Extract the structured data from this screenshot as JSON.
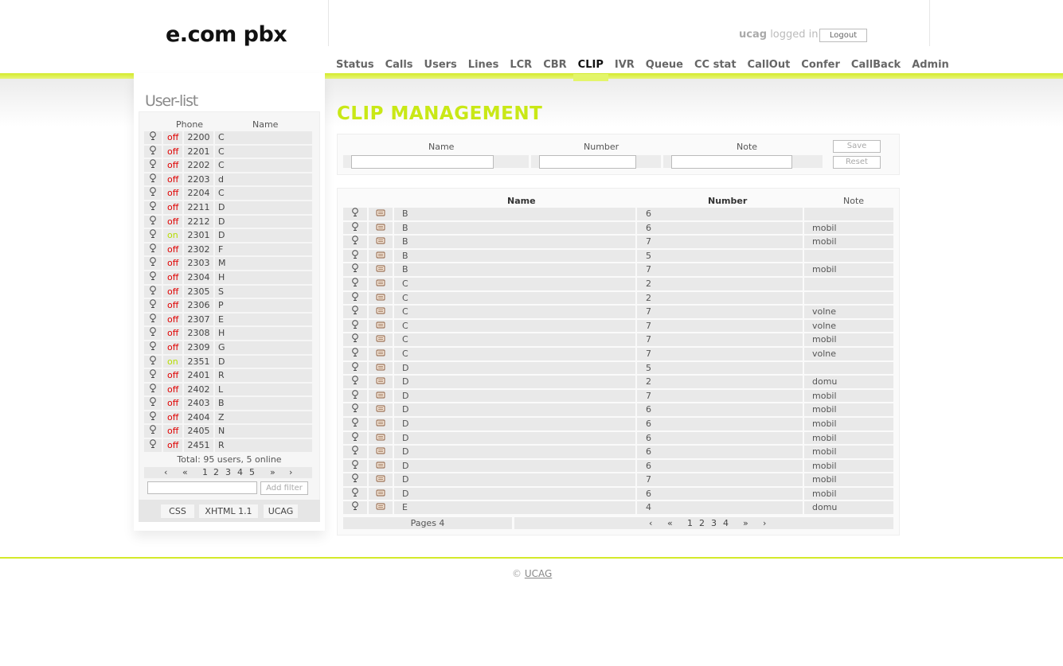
{
  "logo": "e.com pbx",
  "header": {
    "user": "ucag",
    "logged_in_text": "logged in",
    "logout_label": "Logout"
  },
  "nav": [
    "Status",
    "Calls",
    "Users",
    "Lines",
    "LCR",
    "CBR",
    "CLIP",
    "IVR",
    "Queue",
    "CC stat",
    "CallOut",
    "Confer",
    "CallBack",
    "Admin"
  ],
  "nav_active": "CLIP",
  "colors": {
    "accent": "#c9e816",
    "status_off": "#e00000",
    "status_on": "#b6dc00"
  },
  "sidebar": {
    "title": "User-list",
    "col_phone": "Phone",
    "col_name": "Name",
    "users": [
      {
        "status": "off",
        "phone": "2200",
        "name": "C"
      },
      {
        "status": "off",
        "phone": "2201",
        "name": "C"
      },
      {
        "status": "off",
        "phone": "2202",
        "name": "C"
      },
      {
        "status": "off",
        "phone": "2203",
        "name": "d"
      },
      {
        "status": "off",
        "phone": "2204",
        "name": "C"
      },
      {
        "status": "off",
        "phone": "2211",
        "name": "D"
      },
      {
        "status": "off",
        "phone": "2212",
        "name": "D"
      },
      {
        "status": "on",
        "phone": "2301",
        "name": "D"
      },
      {
        "status": "off",
        "phone": "2302",
        "name": "F"
      },
      {
        "status": "off",
        "phone": "2303",
        "name": "M"
      },
      {
        "status": "off",
        "phone": "2304",
        "name": "H"
      },
      {
        "status": "off",
        "phone": "2305",
        "name": "S"
      },
      {
        "status": "off",
        "phone": "2306",
        "name": "P"
      },
      {
        "status": "off",
        "phone": "2307",
        "name": "E"
      },
      {
        "status": "off",
        "phone": "2308",
        "name": "H"
      },
      {
        "status": "off",
        "phone": "2309",
        "name": "G"
      },
      {
        "status": "on",
        "phone": "2351",
        "name": "D"
      },
      {
        "status": "off",
        "phone": "2401",
        "name": "R"
      },
      {
        "status": "off",
        "phone": "2402",
        "name": "L"
      },
      {
        "status": "off",
        "phone": "2403",
        "name": "B"
      },
      {
        "status": "off",
        "phone": "2404",
        "name": "Z"
      },
      {
        "status": "off",
        "phone": "2405",
        "name": "N"
      },
      {
        "status": "off",
        "phone": "2451",
        "name": "R"
      }
    ],
    "total_text": "Total: 95 users, 5 online",
    "pager": {
      "first": "‹",
      "prev": "«",
      "pages": [
        "1",
        "2",
        "3",
        "4",
        "5"
      ],
      "next": "»",
      "last": "›"
    },
    "filter_value": "",
    "filter_button": "Add filter",
    "footer_badges": [
      "CSS",
      "XHTML 1.1",
      "UCAG"
    ]
  },
  "main": {
    "title": "CLIP MANAGEMENT",
    "form": {
      "name_label": "Name",
      "number_label": "Number",
      "note_label": "Note",
      "name_value": "",
      "number_value": "",
      "note_value": "",
      "save_label": "Save",
      "reset_label": "Reset"
    },
    "table": {
      "col_name": "Name",
      "col_number": "Number",
      "col_note": "Note",
      "rows": [
        {
          "name": "B",
          "number": "6",
          "note": ""
        },
        {
          "name": "B",
          "number": "6",
          "note": "mobil"
        },
        {
          "name": "B",
          "number": "7",
          "note": "mobil"
        },
        {
          "name": "B",
          "number": "5",
          "note": ""
        },
        {
          "name": "B",
          "number": "7",
          "note": "mobil"
        },
        {
          "name": "C",
          "number": "2",
          "note": ""
        },
        {
          "name": "C",
          "number": "2",
          "note": ""
        },
        {
          "name": "C",
          "number": "7",
          "note": "volne"
        },
        {
          "name": "C",
          "number": "7",
          "note": "volne"
        },
        {
          "name": "C",
          "number": "7",
          "note": "mobil"
        },
        {
          "name": "C",
          "number": "7",
          "note": "volne"
        },
        {
          "name": "D",
          "number": "5",
          "note": ""
        },
        {
          "name": "D",
          "number": "2",
          "note": "domu"
        },
        {
          "name": "D",
          "number": "7",
          "note": "mobil"
        },
        {
          "name": "D",
          "number": "6",
          "note": "mobil"
        },
        {
          "name": "D",
          "number": "6",
          "note": "mobil"
        },
        {
          "name": "D",
          "number": "6",
          "note": "mobil"
        },
        {
          "name": "D",
          "number": "6",
          "note": "mobil"
        },
        {
          "name": "D",
          "number": "6",
          "note": "mobil"
        },
        {
          "name": "D",
          "number": "7",
          "note": "mobil"
        },
        {
          "name": "D",
          "number": "6",
          "note": "mobil"
        },
        {
          "name": "E",
          "number": "4",
          "note": "domu"
        }
      ],
      "pages_text": "Pages 4",
      "pager": {
        "first": "‹",
        "prev": "«",
        "pages": [
          "1",
          "2",
          "3",
          "4"
        ],
        "next": "»",
        "last": "›"
      }
    }
  },
  "footer": {
    "copyright_symbol": "©",
    "link": "UCAG"
  }
}
